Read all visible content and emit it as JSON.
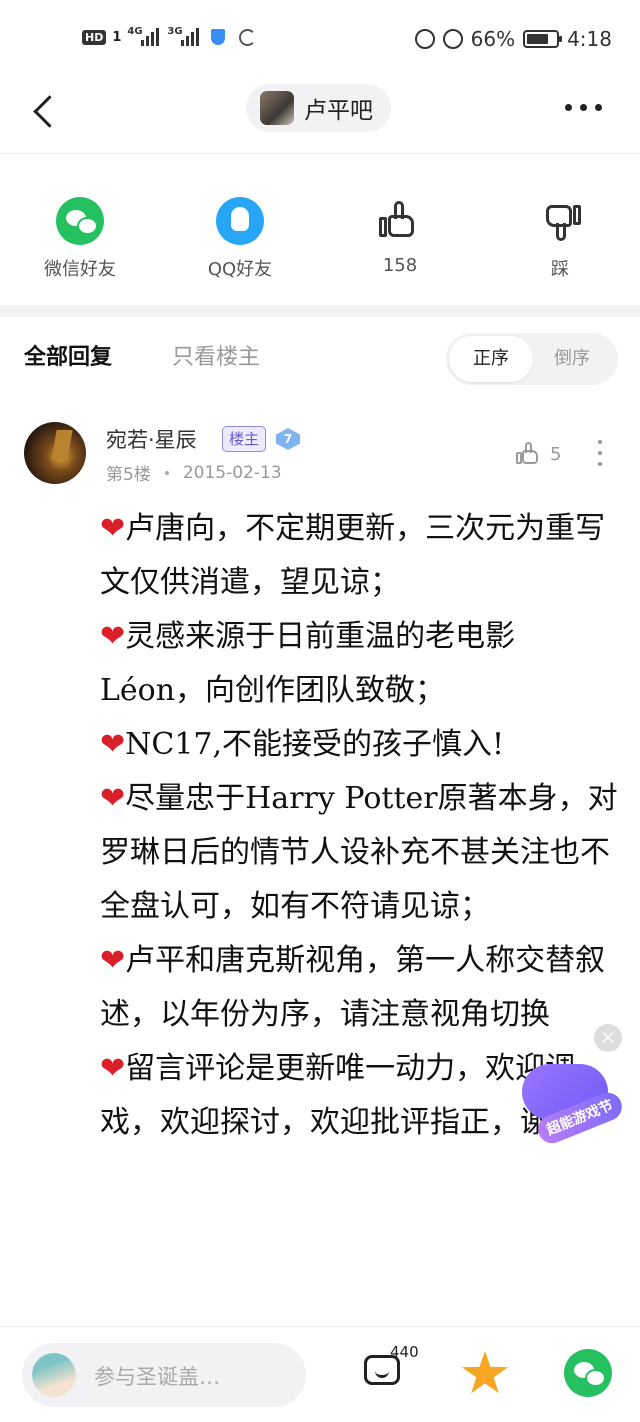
{
  "status_bar": {
    "hd": "HD",
    "sim1": "1",
    "network1": "4G",
    "network2": "3G",
    "battery": "66%",
    "time": "4:18"
  },
  "header": {
    "title": "卢平吧"
  },
  "share": {
    "wechat": "微信好友",
    "qq": "QQ好友",
    "like_count": "158",
    "dislike": "踩"
  },
  "tabs": {
    "all": "全部回复",
    "host_only": "只看楼主",
    "sort_asc": "正序",
    "sort_desc": "倒序"
  },
  "post": {
    "username": "宛若·星辰",
    "host_badge": "楼主",
    "level": "7",
    "floor": "第5楼",
    "date": "2015-02-13",
    "likes": "5",
    "heart": "❤",
    "lines": [
      "卢唐向，不定期更新，三次元为重写文仅供消遣，望见谅；",
      "灵感来源于日前重温的老电影Léon，向创作团队致敬；",
      "NC17,不能接受的孩子慎入!",
      "尽量忠于Harry Potter原著本身，对罗琳日后的情节人设补充不甚关注也不全盘认可，如有不符请见谅；",
      "卢平和唐克斯视角，第一人称交替叙述，以年份为序，请注意视角切换",
      "留言评论是更新唯一动力，欢迎调戏，欢迎探讨，欢迎批评指正，谢谢"
    ]
  },
  "floating": {
    "close": "×",
    "label": "超能游戏节"
  },
  "bottom_bar": {
    "input_placeholder": "参与圣诞盖…",
    "emoji_count": "440"
  },
  "colors": {
    "wechat_green": "#25c160",
    "qq_blue": "#26a6f5",
    "heart_red": "#d91f2a",
    "star_orange": "#f5a623",
    "badge_purple": "#6a5ad6"
  }
}
